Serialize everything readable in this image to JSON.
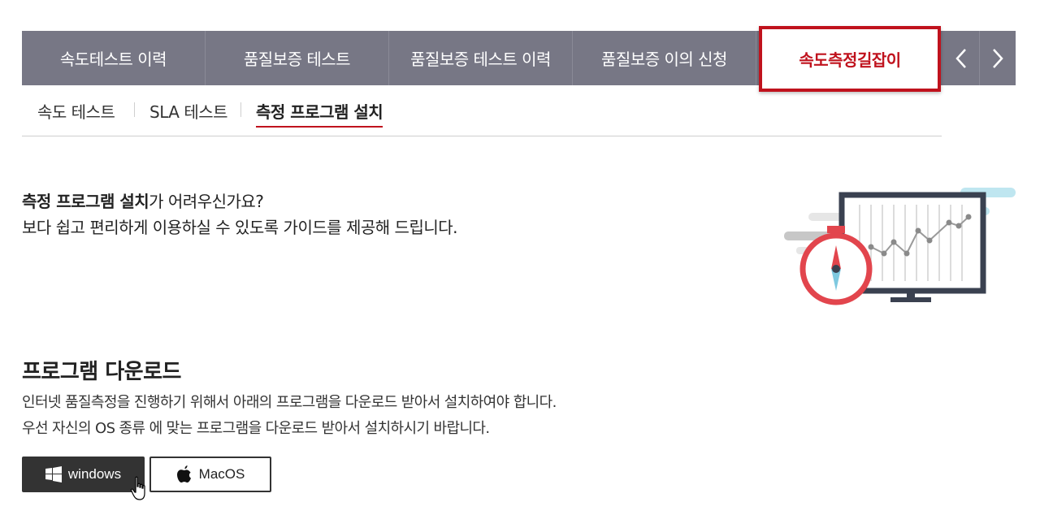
{
  "tabs": [
    {
      "label": "속도테스트 이력"
    },
    {
      "label": "품질보증 테스트"
    },
    {
      "label": "품질보증 테스트 이력"
    },
    {
      "label": "품질보증 이의 신청"
    },
    {
      "label": "속도측정길잡이",
      "active": true
    }
  ],
  "subtabs": [
    {
      "label": "속도 테스트"
    },
    {
      "label": "SLA 테스트"
    },
    {
      "label": "측정 프로그램 설치",
      "active": true
    }
  ],
  "intro": {
    "bold": "측정 프로그램 설치",
    "line1_rest": "가 어려우신가요?",
    "line2": "보다 쉽고 편리하게 이용하실 수 있도록 가이드를 제공해 드립니다."
  },
  "download": {
    "title": "프로그램 다운로드",
    "line1": "인터넷 품질측정을 진행하기 위해서 아래의 프로그램을 다운로드 받아서 설치하여야 합니다.",
    "line2": "우선 자신의 OS 종류 에 맞는 프로그램을 다운로드 받아서 설치하시기 바랍니다.",
    "windows_label": "windows",
    "mac_label": "MacOS"
  },
  "colors": {
    "tabbar": "#777785",
    "accent": "#c0121d",
    "dark_button": "#333333"
  },
  "icons": [
    "chevron-left-icon",
    "chevron-right-icon",
    "windows-icon",
    "apple-icon",
    "hand-cursor-icon"
  ]
}
